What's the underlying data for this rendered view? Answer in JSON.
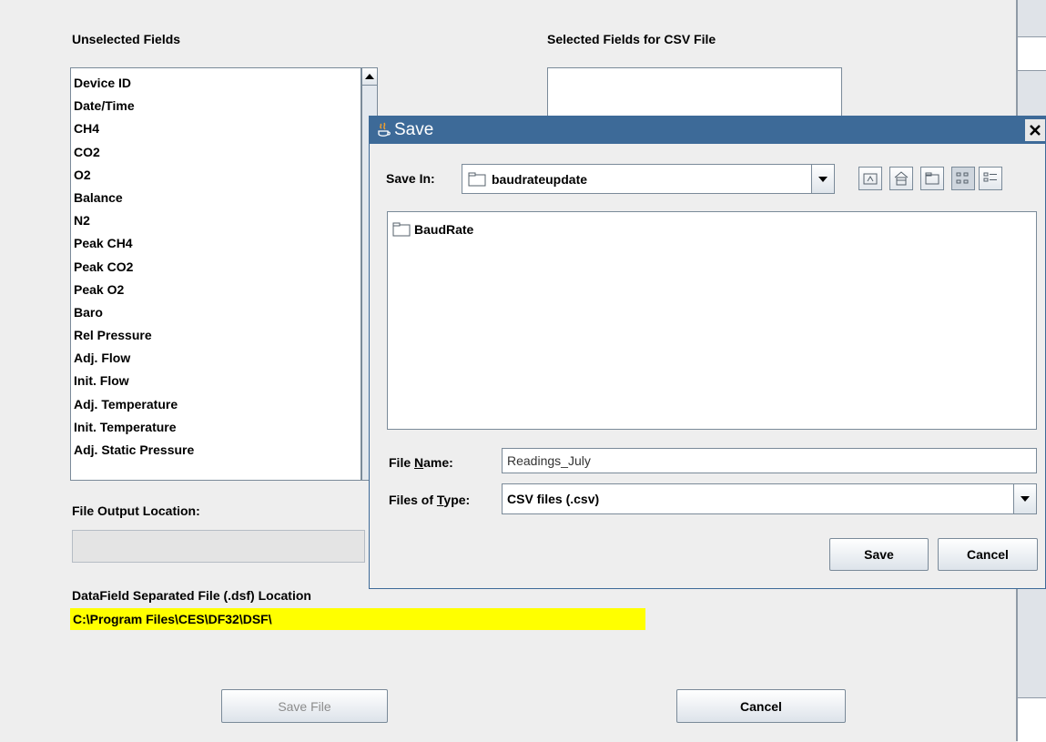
{
  "main": {
    "unselected_title": "Unselected Fields",
    "selected_title": "Selected Fields for CSV File",
    "unselected_fields": [
      "Device ID",
      "Date/Time",
      "CH4",
      "CO2",
      "O2",
      "Balance",
      "N2",
      "Peak CH4",
      "Peak CO2",
      "Peak O2",
      "Baro",
      "Rel Pressure",
      "Adj. Flow",
      "Init. Flow",
      "Adj. Temperature",
      "Init. Temperature",
      "Adj. Static Pressure"
    ],
    "file_output_label": "File Output Location:",
    "file_output_value": "",
    "dsf_label": "DataField Separated File (.dsf)  Location",
    "dsf_path": "C:\\Program Files\\CES\\DF32\\DSF\\",
    "save_file_button": "Save File",
    "cancel_button": "Cancel"
  },
  "dialog": {
    "title": "Save",
    "save_in_label": "Save In:",
    "save_in_value": "baudrateupdate",
    "files": [
      "BaudRate"
    ],
    "file_name_label": "File Name:",
    "file_name_value": "Readings_July",
    "files_of_type_label": "Files of Type:",
    "files_of_type_value": "CSV files (.csv)",
    "save_button": "Save",
    "cancel_button": "Cancel"
  },
  "colors": {
    "title_bar": "#3d6a98",
    "highlight": "#ffff00",
    "panel_bg": "#eeeeee"
  }
}
